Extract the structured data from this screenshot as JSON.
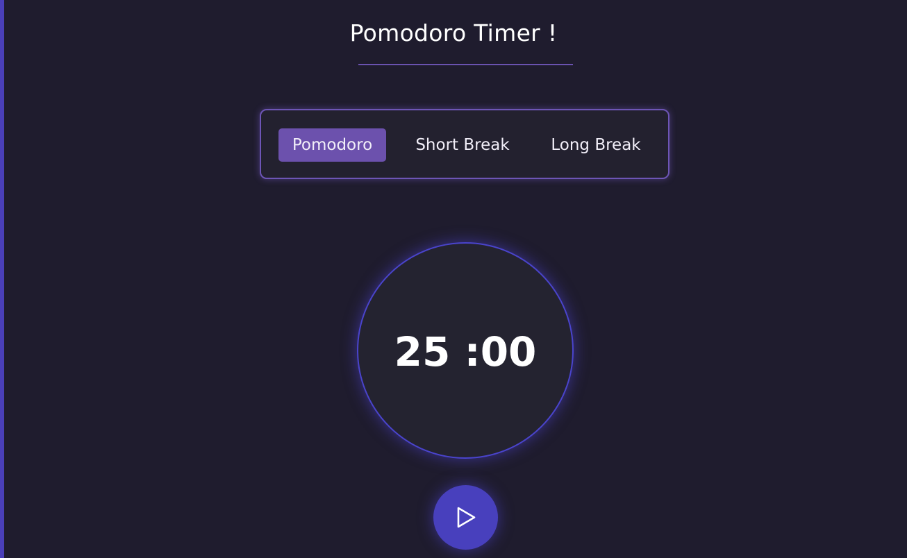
{
  "header": {
    "title": "Pomodoro Timer !"
  },
  "modes": {
    "items": [
      {
        "label": "Pomodoro",
        "active": true
      },
      {
        "label": "Short Break",
        "active": false
      },
      {
        "label": "Long Break",
        "active": false
      }
    ]
  },
  "timer": {
    "display": "25 :00"
  },
  "controls": {
    "play_icon": "play-icon"
  },
  "colors": {
    "background": "#1f1c2e",
    "accent_purple": "#6c51ad",
    "accent_blue": "#4840bd",
    "panel": "#23212f"
  }
}
